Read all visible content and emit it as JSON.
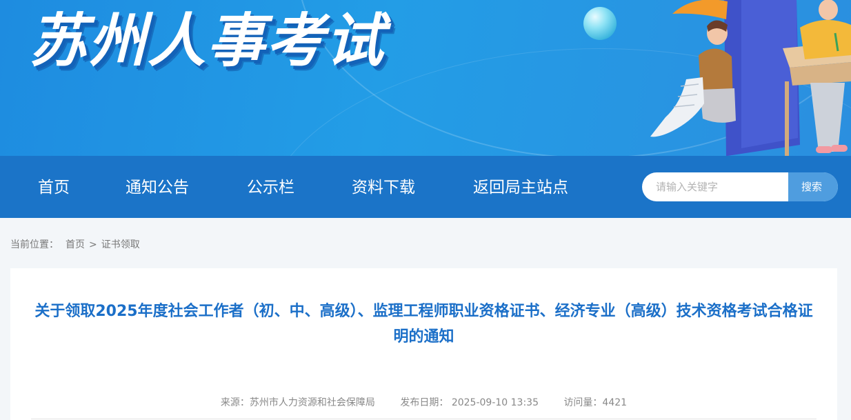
{
  "header": {
    "site_title": "苏州人事考试"
  },
  "nav": {
    "items": [
      "首页",
      "通知公告",
      "公示栏",
      "资料下载",
      "返回局主站点"
    ]
  },
  "search": {
    "placeholder": "请输入关键字",
    "button_label": "搜索"
  },
  "breadcrumb": {
    "prefix": "当前位置：",
    "items": [
      "首页",
      "证书领取"
    ],
    "separator": ">"
  },
  "article": {
    "title": "关于领取2025年度社会工作者（初、中、高级）、监理工程师职业资格证书、经济专业（高级）技术资格考试合格证明的通知",
    "source": "来源：苏州市人力资源和社会保障局",
    "date": "发布日期：  2025-09-10 13:35",
    "views": "访问量：4421"
  },
  "colors": {
    "banner": "#2196e4",
    "nav": "#1b74c8",
    "search_button": "#4f9ddf",
    "title": "#1b6fc8"
  }
}
